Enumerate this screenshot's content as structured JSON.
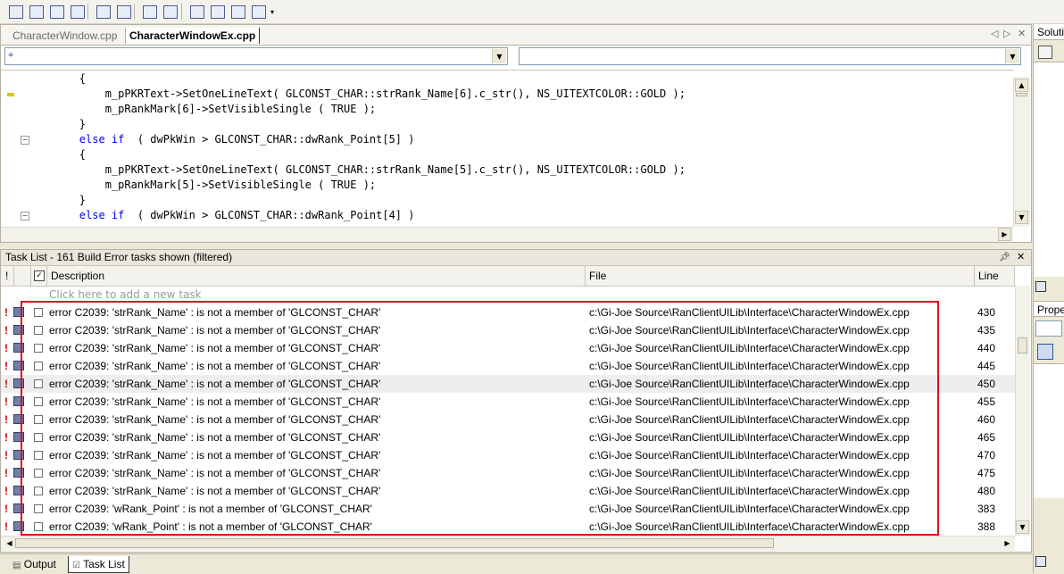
{
  "toolbar": {
    "buttons": [
      "outline-icon",
      "indent-icon",
      "bookmark-icon",
      "font-icon",
      "decrease-indent-icon",
      "increase-indent-icon",
      "comment-icon",
      "uncomment-icon",
      "bookmark-toggle-icon",
      "bookmark-next-icon",
      "bookmark-prev-icon",
      "bookmark-clear-icon",
      "toolbar-options-icon"
    ]
  },
  "editor": {
    "tabs": [
      {
        "label": "CharacterWindow.cpp",
        "active": false
      },
      {
        "label": "CharacterWindowEx.cpp",
        "active": true
      }
    ],
    "code_lines": [
      {
        "indent": "        ",
        "text": "{",
        "kw": ""
      },
      {
        "indent": "            ",
        "text": "m_pPKRText->SetOneLineText( GLCONST_CHAR::strRank_Name[6].c_str(), NS_UITEXTCOLOR::GOLD );",
        "kw": ""
      },
      {
        "indent": "            ",
        "text": "m_pRankMark[6]->SetVisibleSingle ( TRUE );",
        "kw": ""
      },
      {
        "indent": "        ",
        "text": "}",
        "kw": ""
      },
      {
        "indent": "        ",
        "text": "  ( dwPkWin > GLCONST_CHAR::dwRank_Point[5] )",
        "kw": "else if"
      },
      {
        "indent": "        ",
        "text": "{",
        "kw": ""
      },
      {
        "indent": "            ",
        "text": "m_pPKRText->SetOneLineText( GLCONST_CHAR::strRank_Name[5].c_str(), NS_UITEXTCOLOR::GOLD );",
        "kw": ""
      },
      {
        "indent": "            ",
        "text": "m_pRankMark[5]->SetVisibleSingle ( TRUE );",
        "kw": ""
      },
      {
        "indent": "        ",
        "text": "}",
        "kw": ""
      },
      {
        "indent": "        ",
        "text": "  ( dwPkWin > GLCONST_CHAR::dwRank_Point[4] )",
        "kw": "else if"
      }
    ]
  },
  "task_list": {
    "title": "Task List - 161 Build Error tasks shown (filtered)",
    "columns": {
      "priority": "!",
      "description": "Description",
      "file": "File",
      "line": "Line"
    },
    "add_task_placeholder": "Click here to add a new task",
    "rows": [
      {
        "description": "error C2039: 'strRank_Name' : is not a member of 'GLCONST_CHAR'",
        "file": "c:\\Gi-Joe Source\\RanClientUILib\\Interface\\CharacterWindowEx.cpp",
        "line": "430"
      },
      {
        "description": "error C2039: 'strRank_Name' : is not a member of 'GLCONST_CHAR'",
        "file": "c:\\Gi-Joe Source\\RanClientUILib\\Interface\\CharacterWindowEx.cpp",
        "line": "435"
      },
      {
        "description": "error C2039: 'strRank_Name' : is not a member of 'GLCONST_CHAR'",
        "file": "c:\\Gi-Joe Source\\RanClientUILib\\Interface\\CharacterWindowEx.cpp",
        "line": "440"
      },
      {
        "description": "error C2039: 'strRank_Name' : is not a member of 'GLCONST_CHAR'",
        "file": "c:\\Gi-Joe Source\\RanClientUILib\\Interface\\CharacterWindowEx.cpp",
        "line": "445"
      },
      {
        "description": "error C2039: 'strRank_Name' : is not a member of 'GLCONST_CHAR'",
        "file": "c:\\Gi-Joe Source\\RanClientUILib\\Interface\\CharacterWindowEx.cpp",
        "line": "450"
      },
      {
        "description": "error C2039: 'strRank_Name' : is not a member of 'GLCONST_CHAR'",
        "file": "c:\\Gi-Joe Source\\RanClientUILib\\Interface\\CharacterWindowEx.cpp",
        "line": "455"
      },
      {
        "description": "error C2039: 'strRank_Name' : is not a member of 'GLCONST_CHAR'",
        "file": "c:\\Gi-Joe Source\\RanClientUILib\\Interface\\CharacterWindowEx.cpp",
        "line": "460"
      },
      {
        "description": "error C2039: 'strRank_Name' : is not a member of 'GLCONST_CHAR'",
        "file": "c:\\Gi-Joe Source\\RanClientUILib\\Interface\\CharacterWindowEx.cpp",
        "line": "465"
      },
      {
        "description": "error C2039: 'strRank_Name' : is not a member of 'GLCONST_CHAR'",
        "file": "c:\\Gi-Joe Source\\RanClientUILib\\Interface\\CharacterWindowEx.cpp",
        "line": "470"
      },
      {
        "description": "error C2039: 'strRank_Name' : is not a member of 'GLCONST_CHAR'",
        "file": "c:\\Gi-Joe Source\\RanClientUILib\\Interface\\CharacterWindowEx.cpp",
        "line": "475"
      },
      {
        "description": "error C2039: 'strRank_Name' : is not a member of 'GLCONST_CHAR'",
        "file": "c:\\Gi-Joe Source\\RanClientUILib\\Interface\\CharacterWindowEx.cpp",
        "line": "480"
      },
      {
        "description": "error C2039: 'wRank_Point' : is not a member of 'GLCONST_CHAR'",
        "file": "c:\\Gi-Joe Source\\RanClientUILib\\Interface\\CharacterWindowEx.cpp",
        "line": "383"
      },
      {
        "description": "error C2039: 'wRank_Point' : is not a member of 'GLCONST_CHAR'",
        "file": "c:\\Gi-Joe Source\\RanClientUILib\\Interface\\CharacterWindowEx.cpp",
        "line": "388"
      }
    ],
    "selected_row_index": 4
  },
  "bottom_tabs": [
    {
      "label": "Output",
      "active": false
    },
    {
      "label": "Task List",
      "active": true
    }
  ],
  "right_panel": {
    "solution_label": "Soluti",
    "properties_label": "Prope"
  },
  "colors": {
    "highlight_box": "#e0101e",
    "keyword": "#0000ff",
    "error_icon": "#d00000"
  }
}
